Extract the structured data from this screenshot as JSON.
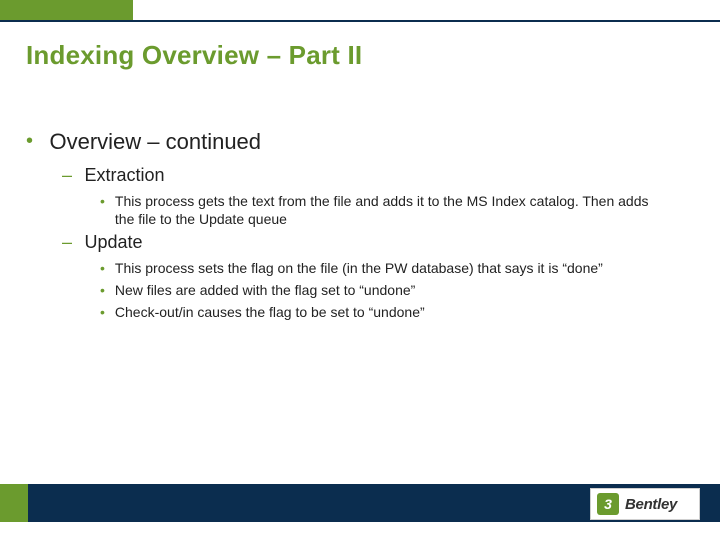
{
  "slide": {
    "title": "Indexing Overview – Part II",
    "bullet": {
      "text": "Overview – continued",
      "subs": [
        {
          "heading": "Extraction",
          "items": [
            "This process gets the text from the file and adds it to the MS Index catalog. Then adds the file to the Update queue"
          ]
        },
        {
          "heading": "Update",
          "items": [
            "This process sets the flag on the file (in the PW database) that says it is “done”",
            "New files are added with the flag set to “undone”",
            "Check-out/in causes the flag to be set to “undone”"
          ]
        }
      ]
    }
  },
  "brand": {
    "mark": "3",
    "name": "Bentley"
  }
}
